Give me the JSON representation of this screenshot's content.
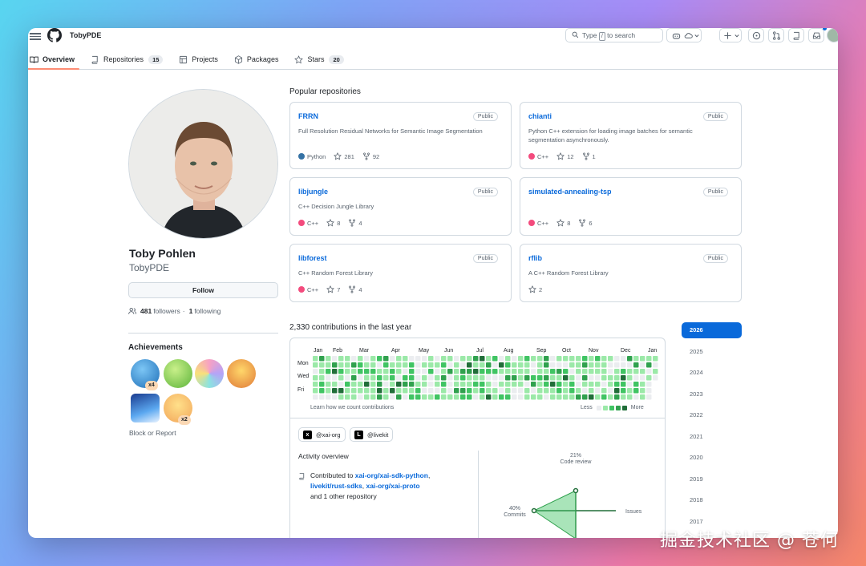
{
  "header": {
    "username": "TobyPDE",
    "search_prefix": "Type",
    "search_key": "/",
    "search_suffix": "to search"
  },
  "tabs": [
    {
      "label": "Overview",
      "count": ""
    },
    {
      "label": "Repositories",
      "count": "15"
    },
    {
      "label": "Projects",
      "count": ""
    },
    {
      "label": "Packages",
      "count": ""
    },
    {
      "label": "Stars",
      "count": "20"
    }
  ],
  "profile": {
    "name": "Toby Pohlen",
    "login": "TobyPDE",
    "follow_label": "Follow",
    "followers_count": "481",
    "followers_label": "followers",
    "dot": "·",
    "following_count": "1",
    "following_label": "following",
    "achievements_title": "Achievements",
    "badges": [
      {
        "name": "pull-shark-badge",
        "multiplier": "x4"
      },
      {
        "name": "pair-extraordinaire-badge",
        "multiplier": ""
      },
      {
        "name": "yolo-badge",
        "multiplier": ""
      },
      {
        "name": "starstruck-badge",
        "multiplier": ""
      },
      {
        "name": "arctic-code-vault-badge",
        "multiplier": ""
      },
      {
        "name": "quickdraw-badge",
        "multiplier": "x2"
      }
    ],
    "block_label": "Block or Report"
  },
  "popular": {
    "title": "Popular repositories",
    "repos": [
      {
        "name": "FRRN",
        "visibility": "Public",
        "description": "Full Resolution Residual Networks for Semantic Image Segmentation",
        "language": "Python",
        "lang_color": "#3572A5",
        "stars": "281",
        "forks": "92"
      },
      {
        "name": "chianti",
        "visibility": "Public",
        "description": "Python C++ extension for loading image batches for semantic segmentation asynchronously.",
        "language": "C++",
        "lang_color": "#f34b7d",
        "stars": "12",
        "forks": "1"
      },
      {
        "name": "libjungle",
        "visibility": "Public",
        "description": "C++ Decision Jungle Library",
        "language": "C++",
        "lang_color": "#f34b7d",
        "stars": "8",
        "forks": "4"
      },
      {
        "name": "simulated-annealing-tsp",
        "visibility": "Public",
        "description": "",
        "language": "C++",
        "lang_color": "#f34b7d",
        "stars": "8",
        "forks": "6"
      },
      {
        "name": "libforest",
        "visibility": "Public",
        "description": "C++ Random Forest Library",
        "language": "C++",
        "lang_color": "#f34b7d",
        "stars": "7",
        "forks": "4"
      },
      {
        "name": "rflib",
        "visibility": "Public",
        "description": "A C++ Random Forest Library",
        "language": "",
        "lang_color": "",
        "stars": "2",
        "forks": ""
      }
    ]
  },
  "contributions": {
    "title": "2,330 contributions in the last year",
    "months": [
      "Jan",
      "Feb",
      "Mar",
      "Apr",
      "May",
      "Jun",
      "Jul",
      "Aug",
      "Sep",
      "Oct",
      "Nov",
      "Dec",
      "Jan"
    ],
    "days": [
      "Mon",
      "Wed",
      "Fri"
    ],
    "learn": "Learn how we count contributions",
    "less": "Less",
    "more": "More",
    "colors": [
      "#ebedf0",
      "#9be9a8",
      "#40c463",
      "#30a14e",
      "#216e39"
    ],
    "orgs": [
      "@xai-org",
      "@livekit"
    ]
  },
  "activity": {
    "title": "Activity overview",
    "contributed_prefix": "Contributed to",
    "repos": [
      "xai-org/xai-sdk-python",
      "livekit/rust-sdks",
      "xai-org/xai-proto"
    ],
    "other": "and 1 other repository",
    "code_review_pct": "21%",
    "code_review_label": "Code review",
    "commits_pct": "40%",
    "commits_label": "Commits",
    "issues_label": "Issues"
  },
  "years": [
    "2026",
    "2025",
    "2024",
    "2023",
    "2022",
    "2021",
    "2020",
    "2019",
    "2018",
    "2017"
  ],
  "selected_year": "2026",
  "watermark": "掘金技术社区 @ 苍何"
}
